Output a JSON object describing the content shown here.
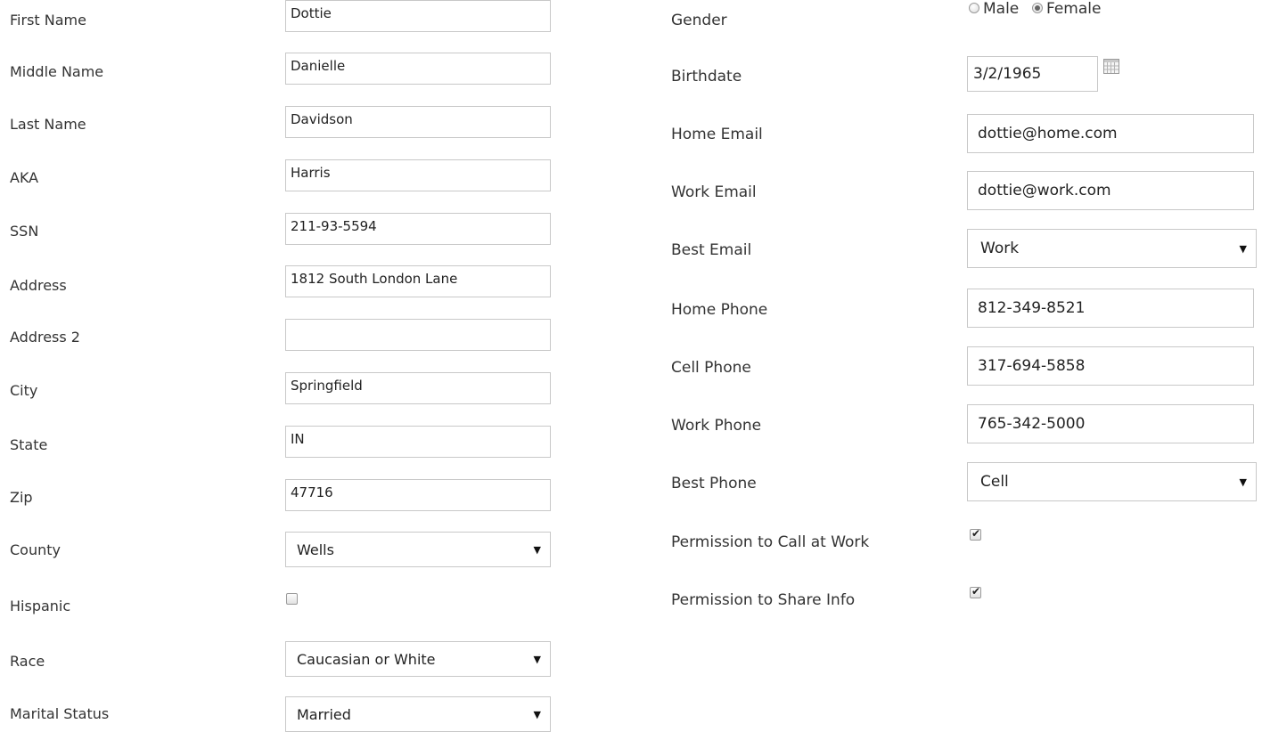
{
  "left": {
    "first_name": {
      "label": "First Name",
      "value": "Dottie"
    },
    "middle_name": {
      "label": "Middle Name",
      "value": "Danielle"
    },
    "last_name": {
      "label": "Last Name",
      "value": "Davidson"
    },
    "aka": {
      "label": "AKA",
      "value": "Harris"
    },
    "ssn": {
      "label": "SSN",
      "value": "211-93-5594"
    },
    "address": {
      "label": "Address",
      "value": "1812 South London Lane"
    },
    "address2": {
      "label": "Address 2",
      "value": ""
    },
    "city": {
      "label": "City",
      "value": "Springfield"
    },
    "state": {
      "label": "State",
      "value": "IN"
    },
    "zip": {
      "label": "Zip",
      "value": "47716"
    },
    "county": {
      "label": "County",
      "selected": "Wells"
    },
    "hispanic": {
      "label": "Hispanic",
      "checked": false
    },
    "race": {
      "label": "Race",
      "selected": "Caucasian or White"
    },
    "marital_status": {
      "label": "Marital Status",
      "selected": "Married"
    }
  },
  "right": {
    "gender": {
      "label": "Gender",
      "options": [
        "Male",
        "Female"
      ],
      "selected": "Female"
    },
    "birthdate": {
      "label": "Birthdate",
      "value": "3/2/1965"
    },
    "home_email": {
      "label": "Home Email",
      "value": "dottie@home.com"
    },
    "work_email": {
      "label": "Work Email",
      "value": "dottie@work.com"
    },
    "best_email": {
      "label": "Best Email",
      "selected": "Work"
    },
    "home_phone": {
      "label": "Home Phone",
      "value": "812-349-8521"
    },
    "cell_phone": {
      "label": "Cell Phone",
      "value": "317-694-5858"
    },
    "work_phone": {
      "label": "Work Phone",
      "value": "765-342-5000"
    },
    "best_phone": {
      "label": "Best Phone",
      "selected": "Cell"
    },
    "permission_call_work": {
      "label": "Permission to Call at Work",
      "checked": true
    },
    "permission_share_info": {
      "label": "Permission to Share Info",
      "checked": true
    }
  },
  "icons": {
    "dropdown_caret": "caret-down-icon",
    "calendar": "calendar-icon",
    "checkmark": "checkmark-icon"
  }
}
